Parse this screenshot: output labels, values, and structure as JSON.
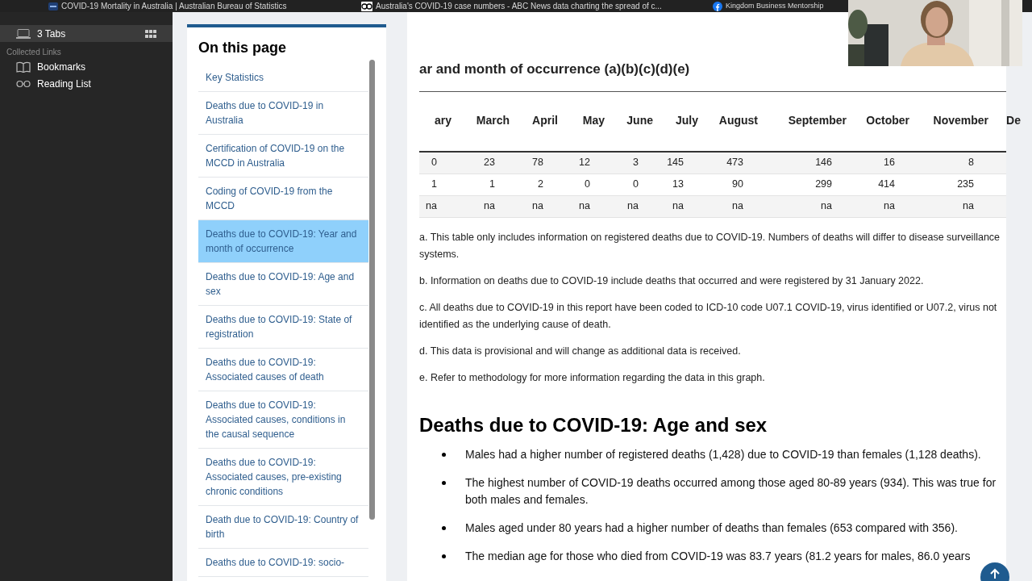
{
  "browser_tabs": [
    {
      "title": "COVID-19 Mortality in Australia | Australian Bureau of Statistics"
    },
    {
      "title": "Australia's COVID-19 case numbers - ABC News data charting the spread of c..."
    },
    {
      "title": "Kingdom Business Mentorship"
    }
  ],
  "sidebar": {
    "tabs_item": {
      "label": "3 Tabs",
      "selected": true
    },
    "section_label": "Collected Links",
    "items": [
      {
        "label": "Bookmarks",
        "kind": "book"
      },
      {
        "label": "Reading List",
        "kind": "glasses"
      }
    ]
  },
  "on_this_page": {
    "title": "On this page",
    "items": [
      {
        "label": "Key Statistics",
        "selected": false
      },
      {
        "label": "Deaths due to COVID-19 in Australia",
        "selected": false
      },
      {
        "label": "Certification of COVID-19 on the MCCD in Australia",
        "selected": false
      },
      {
        "label": "Coding of COVID-19 from the MCCD",
        "selected": false
      },
      {
        "label": "Deaths due to COVID-19: Year and month of occurrence",
        "selected": true
      },
      {
        "label": "Deaths due to COVID-19: Age and sex",
        "selected": false
      },
      {
        "label": "Deaths due to COVID-19: State of registration",
        "selected": false
      },
      {
        "label": "Deaths due to COVID-19: Associated causes of death",
        "selected": false
      },
      {
        "label": "Deaths due to COVID-19: Associated causes, conditions in the causal sequence",
        "selected": false
      },
      {
        "label": "Deaths due to COVID-19: Associated causes, pre-existing chronic conditions",
        "selected": false
      },
      {
        "label": "Death due to COVID-19: Country of birth",
        "selected": false
      },
      {
        "label": "Deaths due to COVID-19: socio-",
        "selected": false
      }
    ]
  },
  "table": {
    "caption": "ar and month of occurrence (a)(b)(c)(d)(e)",
    "columns": [
      "ary",
      "March",
      "April",
      "May",
      "June",
      "July",
      "August",
      "September",
      "October",
      "November",
      "De"
    ],
    "rows": [
      [
        "0",
        "23",
        "78",
        "12",
        "3",
        "145",
        "473",
        "146",
        "16",
        "8"
      ],
      [
        "1",
        "1",
        "2",
        "0",
        "0",
        "13",
        "90",
        "299",
        "414",
        "235"
      ],
      [
        "na",
        "na",
        "na",
        "na",
        "na",
        "na",
        "na",
        "na",
        "na",
        "na"
      ]
    ]
  },
  "notes": [
    "a. This table only includes information on registered deaths due to COVID-19. Numbers of deaths will differ to disease surveillance systems.",
    "b. Information on deaths due to COVID-19 include deaths that occurred and were registered by 31 January 2022.",
    "c. All deaths due to COVID-19 in this report have been coded to ICD-10 code U07.1 COVID-19, virus identified or U07.2, virus not identified as the underlying cause of death.",
    "d. This data is provisional and will change as additional data is received.",
    "e. Refer to methodology for more information regarding the data in this graph."
  ],
  "section": {
    "heading": "Deaths due to COVID-19: Age and sex",
    "bullets": [
      "Males had a higher number of registered deaths (1,428) due to COVID-19 than females (1,128 deaths).",
      "The highest number of COVID-19 deaths occurred among those aged 80-89 years (934). This was true for both males and females.",
      "Males aged under 80 years had a higher number of deaths than females (653 compared with 356).",
      "The median age for those who died from COVID-19 was 83.7 years (81.2 years for males, 86.0 years"
    ]
  }
}
